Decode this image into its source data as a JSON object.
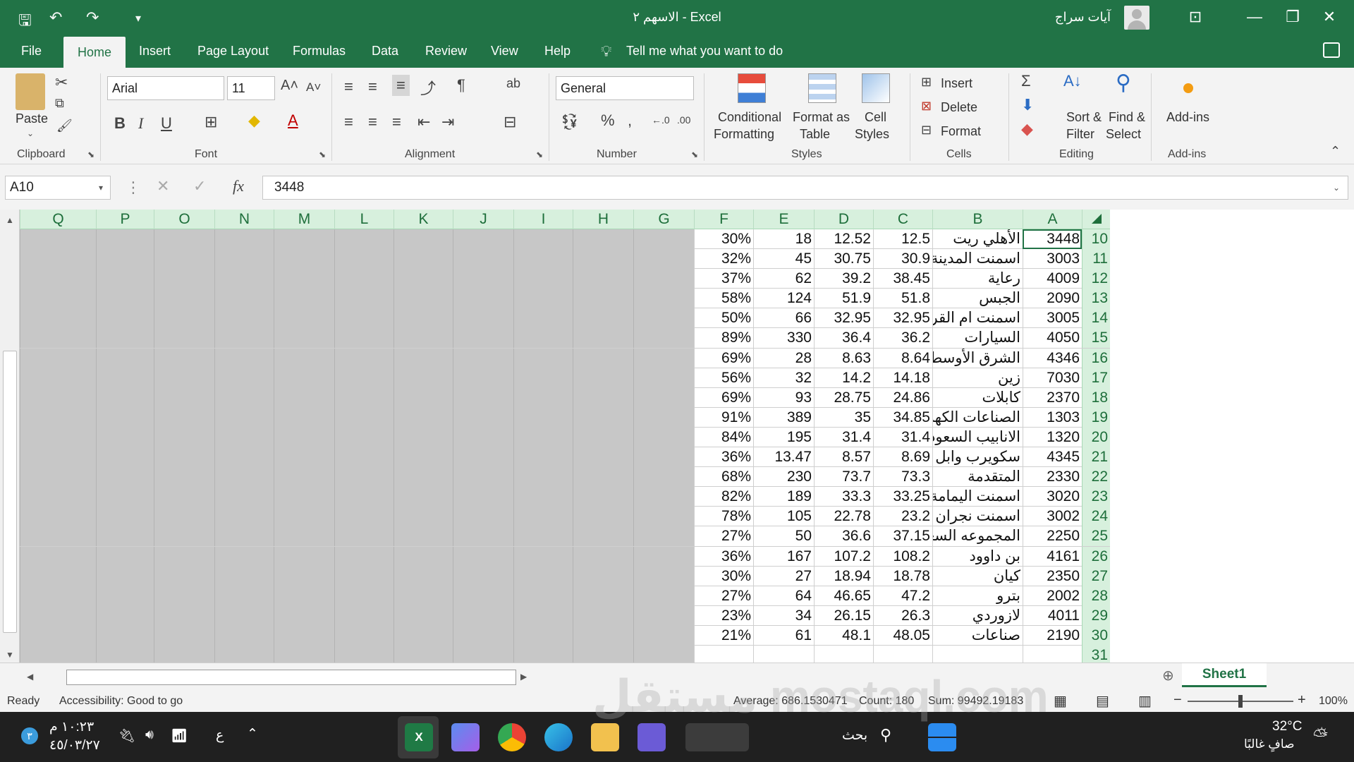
{
  "titlebar": {
    "doc_title": "الاسهم ٢  -  Excel",
    "user_name": "آيات سراج"
  },
  "menu": [
    "File",
    "Home",
    "Insert",
    "Page Layout",
    "Formulas",
    "Data",
    "Review",
    "View",
    "Help"
  ],
  "tell_me": "Tell me what you want to do",
  "ribbon": {
    "clipboard": {
      "paste": "Paste",
      "label": "Clipboard"
    },
    "font": {
      "name": "Arial",
      "size": "11",
      "label": "Font"
    },
    "alignment": {
      "label": "Alignment"
    },
    "number": {
      "format": "General",
      "label": "Number"
    },
    "styles": {
      "conditional_1": "Conditional",
      "conditional_2": "Formatting",
      "format_table_1": "Format as",
      "format_table_2": "Table",
      "cell_styles_1": "Cell",
      "cell_styles_2": "Styles",
      "label": "Styles"
    },
    "cells": {
      "insert": "Insert",
      "delete": "Delete",
      "format": "Format",
      "label": "Cells"
    },
    "editing": {
      "sort_1": "Sort &",
      "sort_2": "Filter",
      "find_1": "Find &",
      "find_2": "Select",
      "label": "Editing"
    },
    "addins": {
      "button": "Add-ins",
      "label": "Add-ins"
    }
  },
  "formula_bar": {
    "name_box": "A10",
    "fx": "fx",
    "value": "3448"
  },
  "columns": [
    "Q",
    "P",
    "O",
    "N",
    "M",
    "L",
    "K",
    "J",
    "I",
    "H",
    "G",
    "F",
    "E",
    "D",
    "C",
    "B",
    "A"
  ],
  "rows": [
    {
      "n": "10",
      "a": "3448",
      "b": "الأهلي ريت",
      "c": "12.5",
      "d": "12.52",
      "e": "18",
      "f": "30%"
    },
    {
      "n": "11",
      "a": "3003",
      "b": "اسمنت المدينة",
      "c": "30.9",
      "d": "30.75",
      "e": "45",
      "f": "32%"
    },
    {
      "n": "12",
      "a": "4009",
      "b": "رعاية",
      "c": "38.45",
      "d": "39.2",
      "e": "62",
      "f": "37%"
    },
    {
      "n": "13",
      "a": "2090",
      "b": "الجبس",
      "c": "51.8",
      "d": "51.9",
      "e": "124",
      "f": "58%"
    },
    {
      "n": "14",
      "a": "3005",
      "b": "اسمنت ام القرى",
      "c": "32.95",
      "d": "32.95",
      "e": "66",
      "f": "50%"
    },
    {
      "n": "15",
      "a": "4050",
      "b": "السيارات",
      "c": "36.2",
      "d": "36.4",
      "e": "330",
      "f": "89%"
    },
    {
      "n": "16",
      "a": "4346",
      "b": "الشرق الأوسط",
      "c": "8.64",
      "d": "8.63",
      "e": "28",
      "f": "69%"
    },
    {
      "n": "17",
      "a": "7030",
      "b": "زين",
      "c": "14.18",
      "d": "14.2",
      "e": "32",
      "f": "56%"
    },
    {
      "n": "18",
      "a": "2370",
      "b": "كابلات",
      "c": "24.86",
      "d": "28.75",
      "e": "93",
      "f": "69%"
    },
    {
      "n": "19",
      "a": "1303",
      "b": "الصناعات الكهربائيه",
      "c": "34.85",
      "d": "35",
      "e": "389",
      "f": "91%"
    },
    {
      "n": "20",
      "a": "1320",
      "b": "الانابيب السعوديه",
      "c": "31.4",
      "d": "31.4",
      "e": "195",
      "f": "84%"
    },
    {
      "n": "21",
      "a": "4345",
      "b": "سكويرب وابل",
      "c": "8.69",
      "d": "8.57",
      "e": "13.47",
      "f": "36%"
    },
    {
      "n": "22",
      "a": "2330",
      "b": "المتقدمة",
      "c": "73.3",
      "d": "73.7",
      "e": "230",
      "f": "68%"
    },
    {
      "n": "23",
      "a": "3020",
      "b": "اسمنت اليمامة",
      "c": "33.25",
      "d": "33.3",
      "e": "189",
      "f": "82%"
    },
    {
      "n": "24",
      "a": "3002",
      "b": "اسمنت نجران",
      "c": "23.2",
      "d": "22.78",
      "e": "105",
      "f": "78%"
    },
    {
      "n": "25",
      "a": "2250",
      "b": "المجموعه السعوديه",
      "c": "37.15",
      "d": "36.6",
      "e": "50",
      "f": "27%"
    },
    {
      "n": "26",
      "a": "4161",
      "b": "بن داوود",
      "c": "108.2",
      "d": "107.2",
      "e": "167",
      "f": "36%"
    },
    {
      "n": "27",
      "a": "2350",
      "b": "كيان",
      "c": "18.78",
      "d": "18.94",
      "e": "27",
      "f": "30%"
    },
    {
      "n": "28",
      "a": "2002",
      "b": "بترو",
      "c": "47.2",
      "d": "46.65",
      "e": "64",
      "f": "27%"
    },
    {
      "n": "29",
      "a": "4011",
      "b": "لازوردي",
      "c": "26.3",
      "d": "26.15",
      "e": "34",
      "f": "23%"
    },
    {
      "n": "30",
      "a": "2190",
      "b": "صناعات",
      "c": "48.05",
      "d": "48.1",
      "e": "61",
      "f": "21%"
    },
    {
      "n": "31",
      "a": "",
      "b": "",
      "c": "",
      "d": "",
      "e": "",
      "f": ""
    }
  ],
  "sheet_tab": "Sheet1",
  "status": {
    "ready": "Ready",
    "accessibility": "Accessibility: Good to go",
    "average": "Average: 686.1530471",
    "count": "Count: 180",
    "sum": "Sum: 99492.19183",
    "zoom": "100%"
  },
  "taskbar": {
    "time": "١٠:٢٣ م",
    "date": "٤٥/٠٣/٢٧",
    "lang": "ع",
    "search": "بحث",
    "temp": "32°C",
    "weather": "صافٍ غالبًا",
    "notif": "٣"
  },
  "watermark": "مستقل mostaql.com",
  "colors": {
    "excel_green": "#217346",
    "header_green": "#d7f0dd",
    "gray_cells": "#c7c7c7"
  }
}
